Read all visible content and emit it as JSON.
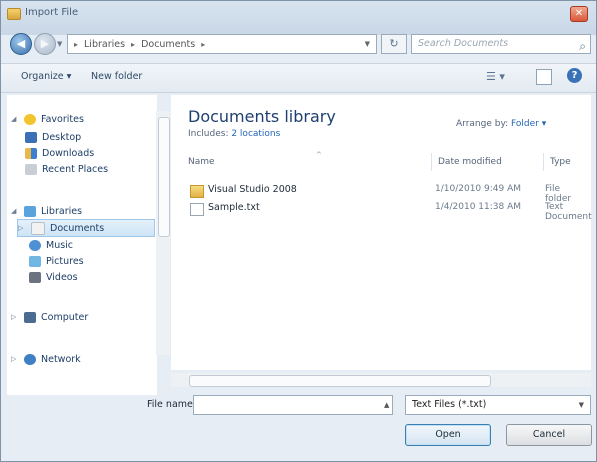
{
  "window": {
    "title": "Import File",
    "close_glyph": "✕"
  },
  "address": {
    "back_glyph": "◀",
    "forward_glyph": "▶",
    "crumbs": [
      "Libraries",
      "Documents"
    ],
    "refresh_glyph": "↻",
    "search_placeholder": "Search Documents"
  },
  "toolbar": {
    "organize": "Organize ▾",
    "new_folder": "New folder",
    "views_glyph": "☰ ▾",
    "help_glyph": "?"
  },
  "nav": {
    "favorites": "Favorites",
    "desktop": "Desktop",
    "downloads": "Downloads",
    "recent": "Recent Places",
    "libraries": "Libraries",
    "documents": "Documents",
    "music": "Music",
    "pictures": "Pictures",
    "videos": "Videos",
    "computer": "Computer",
    "network": "Network"
  },
  "content": {
    "title": "Documents library",
    "includes_prefix": "Includes: ",
    "includes_link": "2 locations",
    "arrange_prefix": "Arrange by: ",
    "arrange_value": "Folder ▾",
    "columns": {
      "name": "Name",
      "date": "Date modified",
      "type": "Type"
    },
    "rows": [
      {
        "name": "Visual Studio 2008",
        "date": "1/10/2010 9:49 AM",
        "type": "File folder"
      },
      {
        "name": "Sample.txt",
        "date": "1/4/2010 11:38 AM",
        "type": "Text Document"
      }
    ]
  },
  "footer": {
    "filename_label": "File name:",
    "filename_value": "",
    "filter_value": "Text Files (*.txt)",
    "open_label": "Open",
    "cancel_label": "Cancel"
  },
  "colors": {
    "accent": "#1e3f6f",
    "link": "#2467b6",
    "selection": "#cde4f6"
  }
}
